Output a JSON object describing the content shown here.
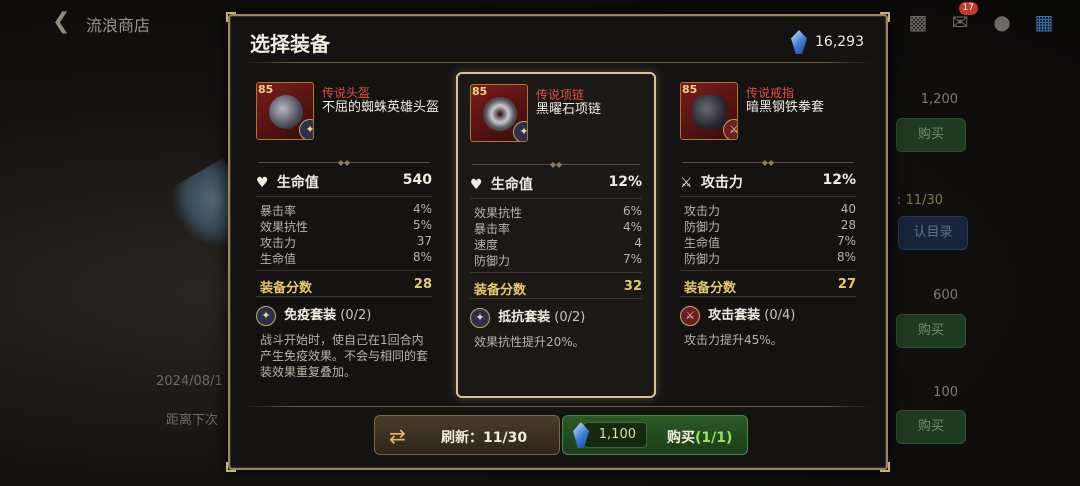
{
  "topbar": {
    "back_icon": "chevron-left-icon",
    "shop_title": "流浪商店",
    "mail_badge": "17"
  },
  "side": {
    "price1": "1,200",
    "buy": "购买",
    "count": ": 11/30",
    "catalog": "认目录",
    "price2": "600",
    "price3": "100"
  },
  "left_info": {
    "date": "2024/08/1",
    "next": "距离下次"
  },
  "dialog": {
    "title": "选择装备",
    "currency_amount": "16,293",
    "refresh_label": "刷新：11/30",
    "buy_price": "1,100",
    "buy_label": "购买",
    "buy_count": "(1/1)"
  },
  "cards": [
    {
      "level": "85",
      "rarity": "传说头盔",
      "name": "不屈的蜘蛛英雄头盔",
      "main_stat": {
        "label": "生命值",
        "value": "540",
        "icon": "heart-icon"
      },
      "subs": [
        {
          "label": "暴击率",
          "value": "4%"
        },
        {
          "label": "效果抗性",
          "value": "5%"
        },
        {
          "label": "攻击力",
          "value": "37"
        },
        {
          "label": "生命值",
          "value": "8%"
        }
      ],
      "score_label": "装备分数",
      "score": "28",
      "set_name": "免疫套装",
      "set_count": "(0/2)",
      "set_desc": "战斗开始时，使自己在1回合内产生免疫效果。不会与相同的套装效果重复叠加。"
    },
    {
      "level": "85",
      "rarity": "传说项链",
      "name": "黑曜石项链",
      "main_stat": {
        "label": "生命值",
        "value": "12%",
        "icon": "heart-icon"
      },
      "subs": [
        {
          "label": "效果抗性",
          "value": "6%"
        },
        {
          "label": "暴击率",
          "value": "4%"
        },
        {
          "label": "速度",
          "value": "4"
        },
        {
          "label": "防御力",
          "value": "7%"
        }
      ],
      "score_label": "装备分数",
      "score": "32",
      "set_name": "抵抗套装",
      "set_count": "(0/2)",
      "set_desc": "效果抗性提升20%。"
    },
    {
      "level": "85",
      "rarity": "传说戒指",
      "name": "暗黑钢铁拳套",
      "main_stat": {
        "label": "攻击力",
        "value": "12%",
        "icon": "sword-icon"
      },
      "subs": [
        {
          "label": "攻击力",
          "value": "40"
        },
        {
          "label": "防御力",
          "value": "28"
        },
        {
          "label": "生命值",
          "value": "7%"
        },
        {
          "label": "防御力",
          "value": "8%"
        }
      ],
      "score_label": "装备分数",
      "score": "27",
      "set_name": "攻击套装",
      "set_count": "(0/4)",
      "set_desc": "攻击力提升45%。"
    }
  ],
  "colors": {
    "accent_gold": "#d9c48c",
    "rarity_red": "#e4503c",
    "score_gold": "#e8c96a",
    "buy_green": "#2b5a26"
  }
}
